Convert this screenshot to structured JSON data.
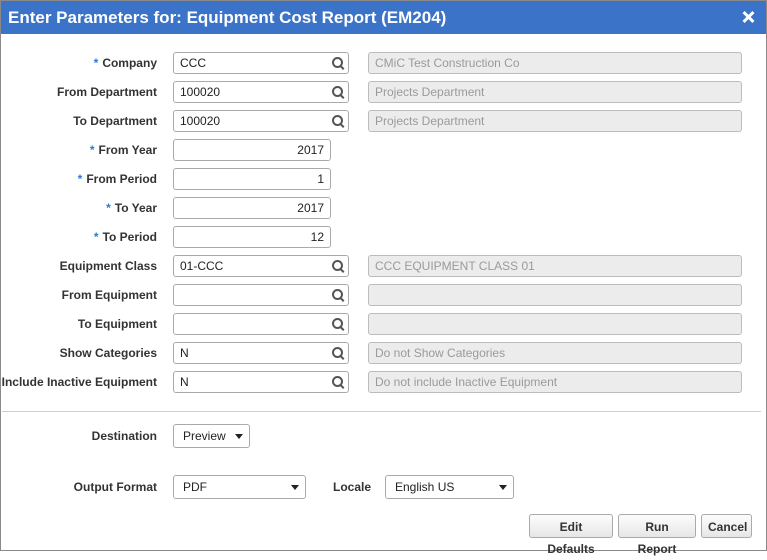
{
  "dialog": {
    "title": "Enter Parameters for: Equipment Cost Report (EM204)"
  },
  "required_marker": "*",
  "fields": {
    "company": {
      "label": "Company",
      "value": "CCC",
      "description": "CMiC Test Construction Co"
    },
    "from_department": {
      "label": "From Department",
      "value": "100020",
      "description": "Projects Department"
    },
    "to_department": {
      "label": "To Department",
      "value": "100020",
      "description": "Projects Department"
    },
    "from_year": {
      "label": "From Year",
      "value": "2017"
    },
    "from_period": {
      "label": "From Period",
      "value": "1"
    },
    "to_year": {
      "label": "To Year",
      "value": "2017"
    },
    "to_period": {
      "label": "To Period",
      "value": "12"
    },
    "equipment_class": {
      "label": "Equipment Class",
      "value": "01-CCC",
      "description": "CCC EQUIPMENT CLASS 01"
    },
    "from_equipment": {
      "label": "From Equipment",
      "value": "",
      "description": ""
    },
    "to_equipment": {
      "label": "To Equipment",
      "value": "",
      "description": ""
    },
    "show_categories": {
      "label": "Show Categories",
      "value": "N",
      "description": "Do not Show Categories"
    },
    "include_inactive": {
      "label": "Include Inactive Equipment",
      "value": "N",
      "description": "Do not include Inactive Equipment"
    }
  },
  "destination": {
    "label": "Destination",
    "value": "Preview"
  },
  "output_format": {
    "label": "Output Format",
    "value": "PDF"
  },
  "locale": {
    "label": "Locale",
    "value": "English US"
  },
  "buttons": {
    "edit_defaults": "Edit Defaults",
    "run_report": "Run Report",
    "cancel": "Cancel"
  },
  "icons": {
    "lookup": "magnifier-icon",
    "close": "close-icon",
    "dropdown": "chevron-down-icon"
  },
  "colors": {
    "titlebar": "#3b73c8",
    "required": "#2a7ad0"
  }
}
